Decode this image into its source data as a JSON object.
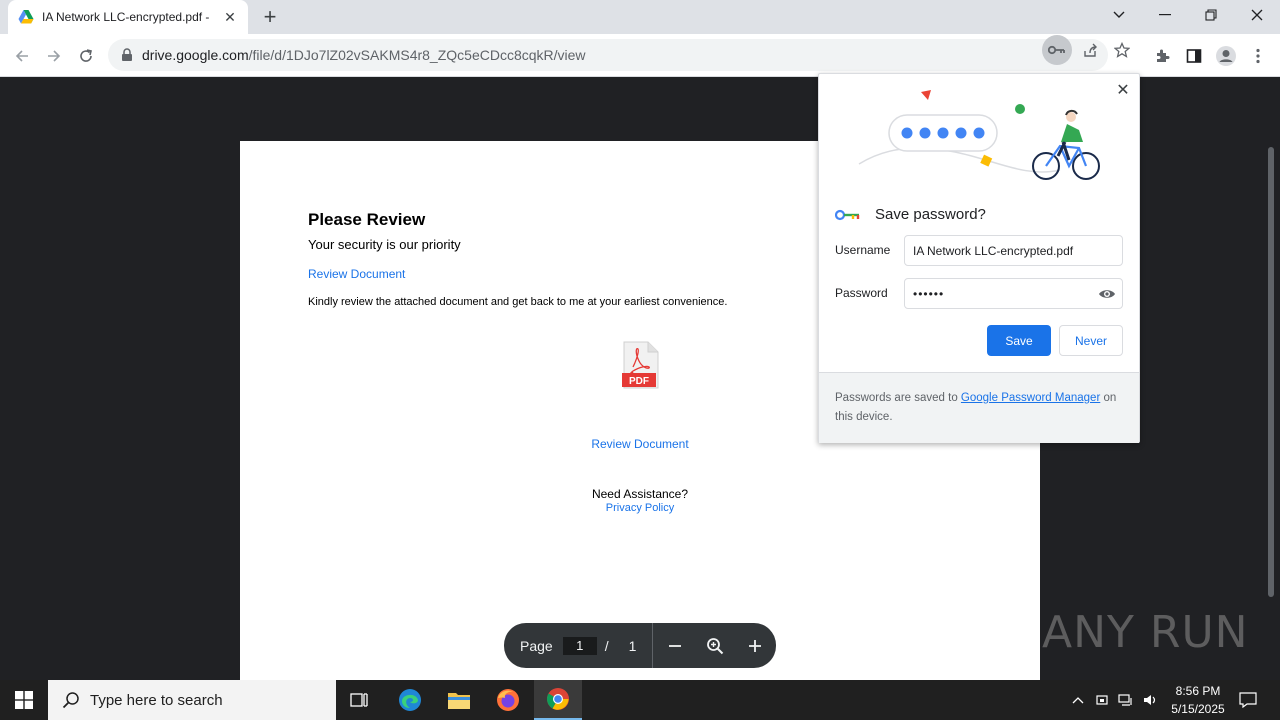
{
  "browser": {
    "tab_title": "IA Network LLC-encrypted.pdf -",
    "tab_close": "✕",
    "new_tab": "+",
    "url_host": "drive.google.com",
    "url_path": "/file/d/1DJo7lZ02vSAKMS4r8_ZQc5eCDcc8cqkR/view"
  },
  "document": {
    "heading": "Please Review",
    "subheading": "Your security is our priority",
    "link_top": "Review Document",
    "body": "Kindly review the attached document and get back to me at your earliest convenience.",
    "pdf_label": "PDF",
    "link_center": "Review Document",
    "assistance": "Need Assistance?",
    "privacy": "Privacy Policy"
  },
  "page_control": {
    "label": "Page",
    "current": "1",
    "separator": "/",
    "total": "1",
    "zoom_out": "−",
    "zoom_in": "+"
  },
  "password_bubble": {
    "title": "Save password?",
    "username_label": "Username",
    "username_value": "IA Network LLC-encrypted.pdf",
    "password_label": "Password",
    "password_value": "••••••",
    "save_label": "Save",
    "never_label": "Never",
    "footer_prefix": "Passwords are saved to ",
    "footer_link": "Google Password Manager",
    "footer_suffix": " on this device.",
    "close": "✕"
  },
  "watermark": "ANY RUN",
  "taskbar": {
    "search_placeholder": "Type here to search",
    "time": "8:56 PM",
    "date": "5/15/2025"
  },
  "colors": {
    "accent": "#1a73e8",
    "viewer_bg": "#202124",
    "taskbar_bg": "#202020"
  }
}
